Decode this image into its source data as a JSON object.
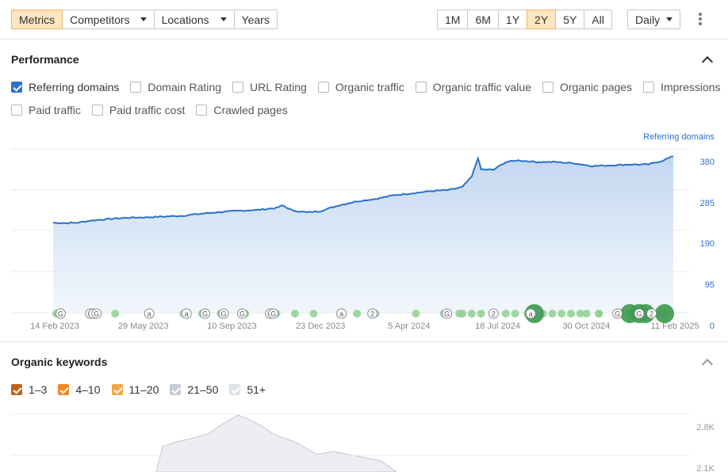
{
  "toolbar": {
    "left_tabs": [
      {
        "label": "Metrics",
        "active": true,
        "dropdown": false
      },
      {
        "label": "Competitors",
        "active": false,
        "dropdown": true
      },
      {
        "label": "Locations",
        "active": false,
        "dropdown": true
      },
      {
        "label": "Years",
        "active": false,
        "dropdown": false
      }
    ],
    "ranges": [
      {
        "label": "1M",
        "active": false
      },
      {
        "label": "6M",
        "active": false
      },
      {
        "label": "1Y",
        "active": false
      },
      {
        "label": "2Y",
        "active": true
      },
      {
        "label": "5Y",
        "active": false
      },
      {
        "label": "All",
        "active": false
      }
    ],
    "interval": "Daily",
    "more_icon": "kebab-icon"
  },
  "performance": {
    "title": "Performance",
    "metrics": [
      {
        "label": "Referring domains",
        "checked": true
      },
      {
        "label": "Domain Rating",
        "checked": false
      },
      {
        "label": "URL Rating",
        "checked": false
      },
      {
        "label": "Organic traffic",
        "checked": false
      },
      {
        "label": "Organic traffic value",
        "checked": false
      },
      {
        "label": "Organic pages",
        "checked": false
      },
      {
        "label": "Impressions",
        "checked": false
      },
      {
        "label": "Paid traffic",
        "checked": false
      },
      {
        "label": "Paid traffic cost",
        "checked": false
      },
      {
        "label": "Crawled pages",
        "checked": false
      }
    ]
  },
  "organic_keywords": {
    "title": "Organic keywords",
    "filters": [
      {
        "label": "1–3",
        "checked": true,
        "color": "#c0621a"
      },
      {
        "label": "4–10",
        "checked": true,
        "color": "#f08a24"
      },
      {
        "label": "11–20",
        "checked": true,
        "color": "#f5a648"
      },
      {
        "label": "21–50",
        "checked": true,
        "color": "#c5ccd6"
      },
      {
        "label": "51+",
        "checked": true,
        "color": "#dde2e8"
      }
    ]
  },
  "chart_data": [
    {
      "type": "area",
      "series": [
        {
          "name": "Referring domains",
          "color": "#2a71c9"
        }
      ],
      "x_ticks": [
        "14 Feb 2023",
        "29 May 2023",
        "10 Sep 2023",
        "23 Dec 2023",
        "5 Apr 2024",
        "18 Jul 2024",
        "30 Oct 2024",
        "11 Feb 2025"
      ],
      "y_ticks": [
        "380",
        "285",
        "190",
        "95",
        "0"
      ],
      "ylim": [
        0,
        400
      ],
      "points": [
        [
          0,
          220
        ],
        [
          0.02,
          219
        ],
        [
          0.04,
          220
        ],
        [
          0.06,
          225
        ],
        [
          0.09,
          229
        ],
        [
          0.12,
          232
        ],
        [
          0.15,
          233
        ],
        [
          0.18,
          235
        ],
        [
          0.21,
          237
        ],
        [
          0.24,
          242
        ],
        [
          0.27,
          246
        ],
        [
          0.3,
          249
        ],
        [
          0.33,
          251
        ],
        [
          0.36,
          256
        ],
        [
          0.37,
          262
        ],
        [
          0.385,
          250
        ],
        [
          0.41,
          245
        ],
        [
          0.43,
          248
        ],
        [
          0.46,
          262
        ],
        [
          0.49,
          272
        ],
        [
          0.52,
          278
        ],
        [
          0.55,
          287
        ],
        [
          0.58,
          292
        ],
        [
          0.61,
          297
        ],
        [
          0.64,
          300
        ],
        [
          0.66,
          307
        ],
        [
          0.675,
          332
        ],
        [
          0.685,
          378
        ],
        [
          0.69,
          350
        ],
        [
          0.71,
          349
        ],
        [
          0.73,
          368
        ],
        [
          0.75,
          372
        ],
        [
          0.78,
          368
        ],
        [
          0.81,
          368
        ],
        [
          0.84,
          365
        ],
        [
          0.87,
          358
        ],
        [
          0.9,
          360
        ],
        [
          0.93,
          362
        ],
        [
          0.96,
          362
        ],
        [
          0.98,
          370
        ],
        [
          1.0,
          382
        ]
      ],
      "annotations": {
        "markers": [
          0.005,
          0.012,
          0.06,
          0.065,
          0.07,
          0.1,
          0.155,
          0.21,
          0.215,
          0.24,
          0.27,
          0.31,
          0.36,
          0.39,
          0.42,
          0.465,
          0.49,
          0.515,
          0.52,
          0.585,
          0.63,
          0.655,
          0.66,
          0.675,
          0.69,
          0.71,
          0.73,
          0.745,
          0.765,
          0.77,
          0.79,
          0.805,
          0.82,
          0.835,
          0.85,
          0.86,
          0.88,
          0.88,
          0.91,
          0.93,
          0.94,
          0.96,
          0.975,
          0.985
        ],
        "letters": [
          {
            "x": 0.012,
            "t": "G"
          },
          {
            "x": 0.06,
            "t": "G"
          },
          {
            "x": 0.065,
            "t": "a"
          },
          {
            "x": 0.07,
            "t": "G"
          },
          {
            "x": 0.155,
            "t": "a"
          },
          {
            "x": 0.215,
            "t": "a"
          },
          {
            "x": 0.245,
            "t": "G"
          },
          {
            "x": 0.275,
            "t": "G"
          },
          {
            "x": 0.305,
            "t": "G"
          },
          {
            "x": 0.35,
            "t": "G"
          },
          {
            "x": 0.355,
            "t": "G"
          },
          {
            "x": 0.465,
            "t": "a"
          },
          {
            "x": 0.515,
            "t": "2"
          },
          {
            "x": 0.635,
            "t": "G"
          },
          {
            "x": 0.71,
            "t": "2"
          },
          {
            "x": 0.77,
            "t": "a"
          },
          {
            "x": 0.91,
            "t": "G"
          },
          {
            "x": 0.945,
            "t": "G"
          },
          {
            "x": 0.965,
            "t": "2"
          }
        ],
        "big": [
          0.776,
          0.93,
          0.945,
          0.955,
          0.986
        ]
      },
      "legend": "Referring domains"
    },
    {
      "type": "area",
      "series": [
        {
          "name": "Organic keywords",
          "color": "#c6ccd4"
        }
      ],
      "y_ticks": [
        "2.8K",
        "2.1K"
      ]
    }
  ]
}
